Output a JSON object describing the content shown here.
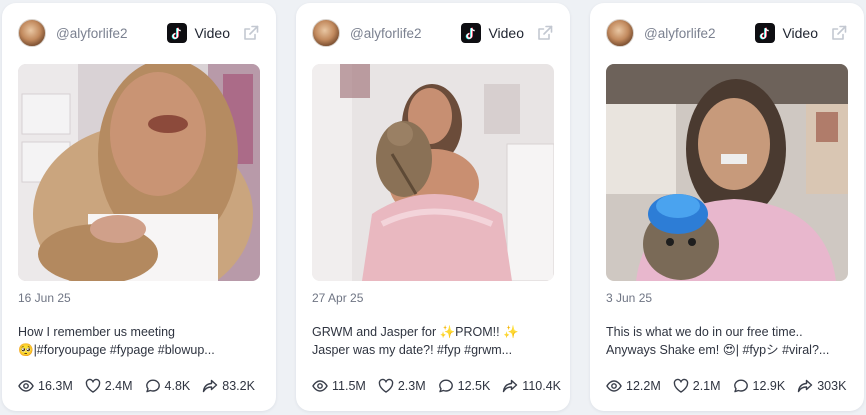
{
  "cards": [
    {
      "handle": "@alyforlife2",
      "platform_label": "Video",
      "date": "16 Jun 25",
      "caption_line1": "How I remember us meeting",
      "caption_line2": "🥺|#foryoupage #fypage #blowup...",
      "views": "16.3M",
      "likes": "2.4M",
      "comments": "4.8K",
      "shares": "83.2K"
    },
    {
      "handle": "@alyforlife2",
      "platform_label": "Video",
      "date": "27 Apr 25",
      "caption_line1": "GRWM and Jasper for ✨PROM!! ✨",
      "caption_line2": "Jasper was my date?! #fyp #grwm...",
      "views": "11.5M",
      "likes": "2.3M",
      "comments": "12.5K",
      "shares": "110.4K"
    },
    {
      "handle": "@alyforlife2",
      "platform_label": "Video",
      "date": "3 Jun 25",
      "caption_line1": "This is what we do in our free time..",
      "caption_line2": "Anyways Shake em! 😍| #fypシ #viral?...",
      "views": "12.2M",
      "likes": "2.1M",
      "comments": "12.9K",
      "shares": "303K"
    }
  ],
  "icons": {
    "avatar": "avatar",
    "platform": "tiktok-icon",
    "open": "external-link-icon",
    "views": "eye-icon",
    "likes": "heart-icon",
    "comments": "comment-icon",
    "shares": "share-icon"
  },
  "colors": {
    "page_background": "#eef1f5",
    "card_background": "#ffffff",
    "muted_text": "#7b8190"
  }
}
